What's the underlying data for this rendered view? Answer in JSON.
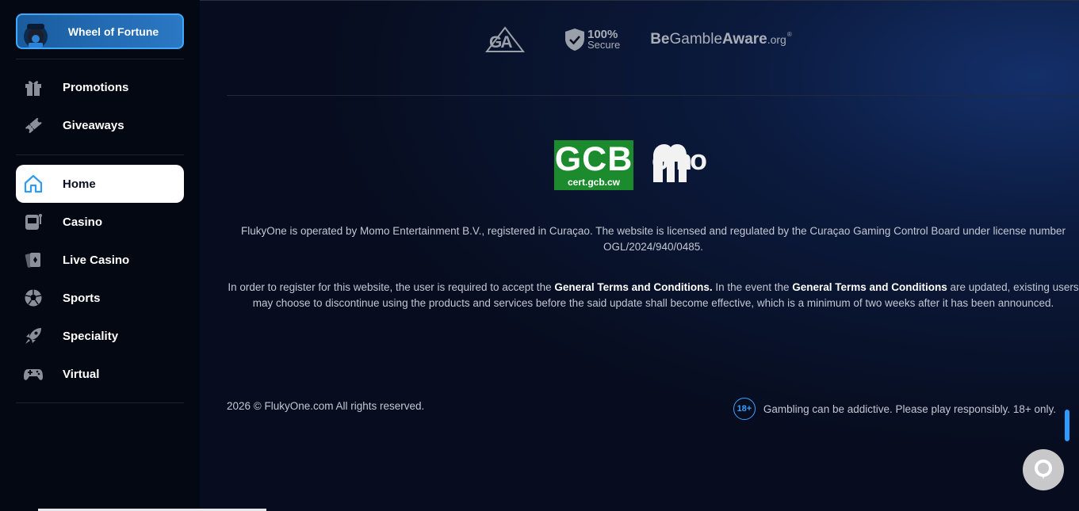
{
  "sidebar": {
    "wheel_button": "Wheel of Fortune",
    "group1": [
      {
        "label": "Promotions",
        "icon": "gift-icon"
      },
      {
        "label": "Giveaways",
        "icon": "ticket-icon"
      }
    ],
    "group2": [
      {
        "label": "Home",
        "icon": "home-icon",
        "active": true
      },
      {
        "label": "Casino",
        "icon": "slot-machine-icon"
      },
      {
        "label": "Live Casino",
        "icon": "cards-icon"
      },
      {
        "label": "Sports",
        "icon": "soccer-ball-icon"
      },
      {
        "label": "Speciality",
        "icon": "rocket-icon"
      },
      {
        "label": "Virtual",
        "icon": "gamepad-icon"
      }
    ]
  },
  "footer": {
    "trust": {
      "ga": "GA",
      "secure_pct": "100%",
      "secure_label": "Secure",
      "bga_be": "Be",
      "bga_gamble": "Gamble",
      "bga_aware": "Aware",
      "bga_org": ".org",
      "bga_reg": "®"
    },
    "gcb": {
      "big": "GCB",
      "small": "cert.gcb.cw"
    },
    "momo_logo": "omo",
    "license_text": "FlukyOne is operated by Momo Entertainment B.V., registered in Curaçao. The website is licensed and regulated by the Curaçao Gaming Control Board under license number OGL/2024/940/0485.",
    "terms": {
      "part1": "In order to register for this website, the user is required to accept the ",
      "link1": "General Terms and Conditions.",
      "part2": " In the event the ",
      "link2": "General Terms and Conditions",
      "part3": " are updated, existing users may choose to discontinue using the products and services before the said update shall become effective, which is a minimum of two weeks after it has been announced."
    },
    "copyright": "2026 © FlukyOne.com All rights reserved.",
    "age_badge": "18+",
    "age_text": "Gambling can be addictive. Please play responsibly. 18+ only."
  },
  "colors": {
    "accent": "#3da9ff",
    "gcb_green": "#1c8b2e",
    "bg": "#070d1f"
  }
}
